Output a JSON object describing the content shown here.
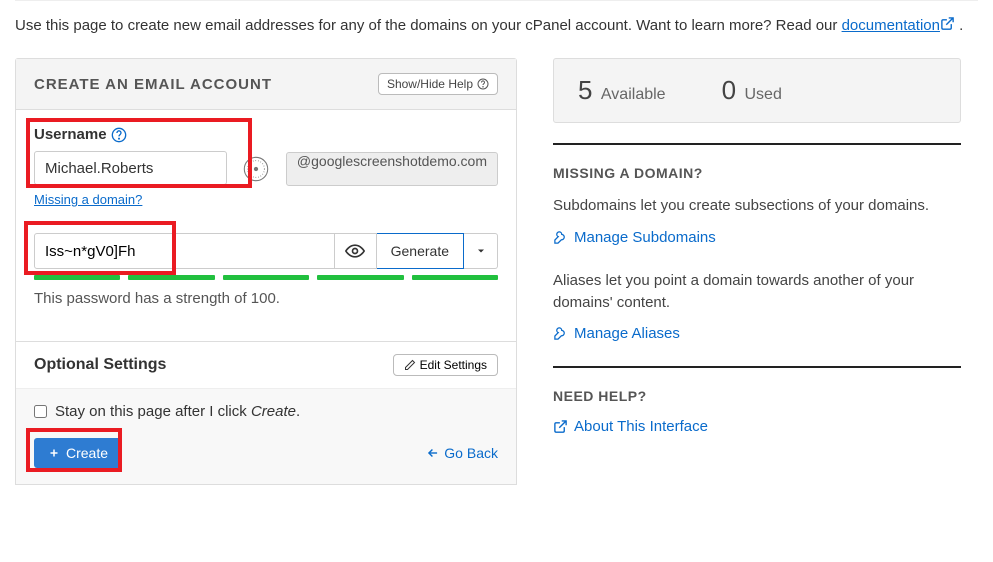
{
  "intro": {
    "text": "Use this page to create new email addresses for any of the domains on your cPanel account. Want to learn more? Read our ",
    "link": "documentation",
    "period": " ."
  },
  "panel": {
    "title": "CREATE AN EMAIL ACCOUNT",
    "show_help": "Show/Hide Help"
  },
  "username": {
    "label": "Username",
    "value": "Michael.Roberts",
    "domain": "@googlescreenshotdemo.com",
    "missing": "Missing a domain?"
  },
  "password": {
    "value": "Iss~n*gV0]Fh",
    "generate": "Generate",
    "strength_text": "This password has a strength of 100."
  },
  "optional": {
    "title": "Optional Settings",
    "edit": "Edit Settings"
  },
  "footer": {
    "stay_prefix": "Stay on this page after I click ",
    "stay_em": "Create",
    "stay_suffix": ".",
    "create": "Create",
    "goback": "Go Back"
  },
  "stats": {
    "available_num": "5",
    "available_lbl": "Available",
    "used_num": "0",
    "used_lbl": "Used"
  },
  "missing_domain": {
    "head": "MISSING A DOMAIN?",
    "sub_desc": "Subdomains let you create subsections of your domains.",
    "sub_link": "Manage Subdomains",
    "alias_desc": "Aliases let you point a domain towards another of your domains' content.",
    "alias_link": "Manage Aliases"
  },
  "need_help": {
    "head": "NEED HELP?",
    "link": "About This Interface"
  }
}
